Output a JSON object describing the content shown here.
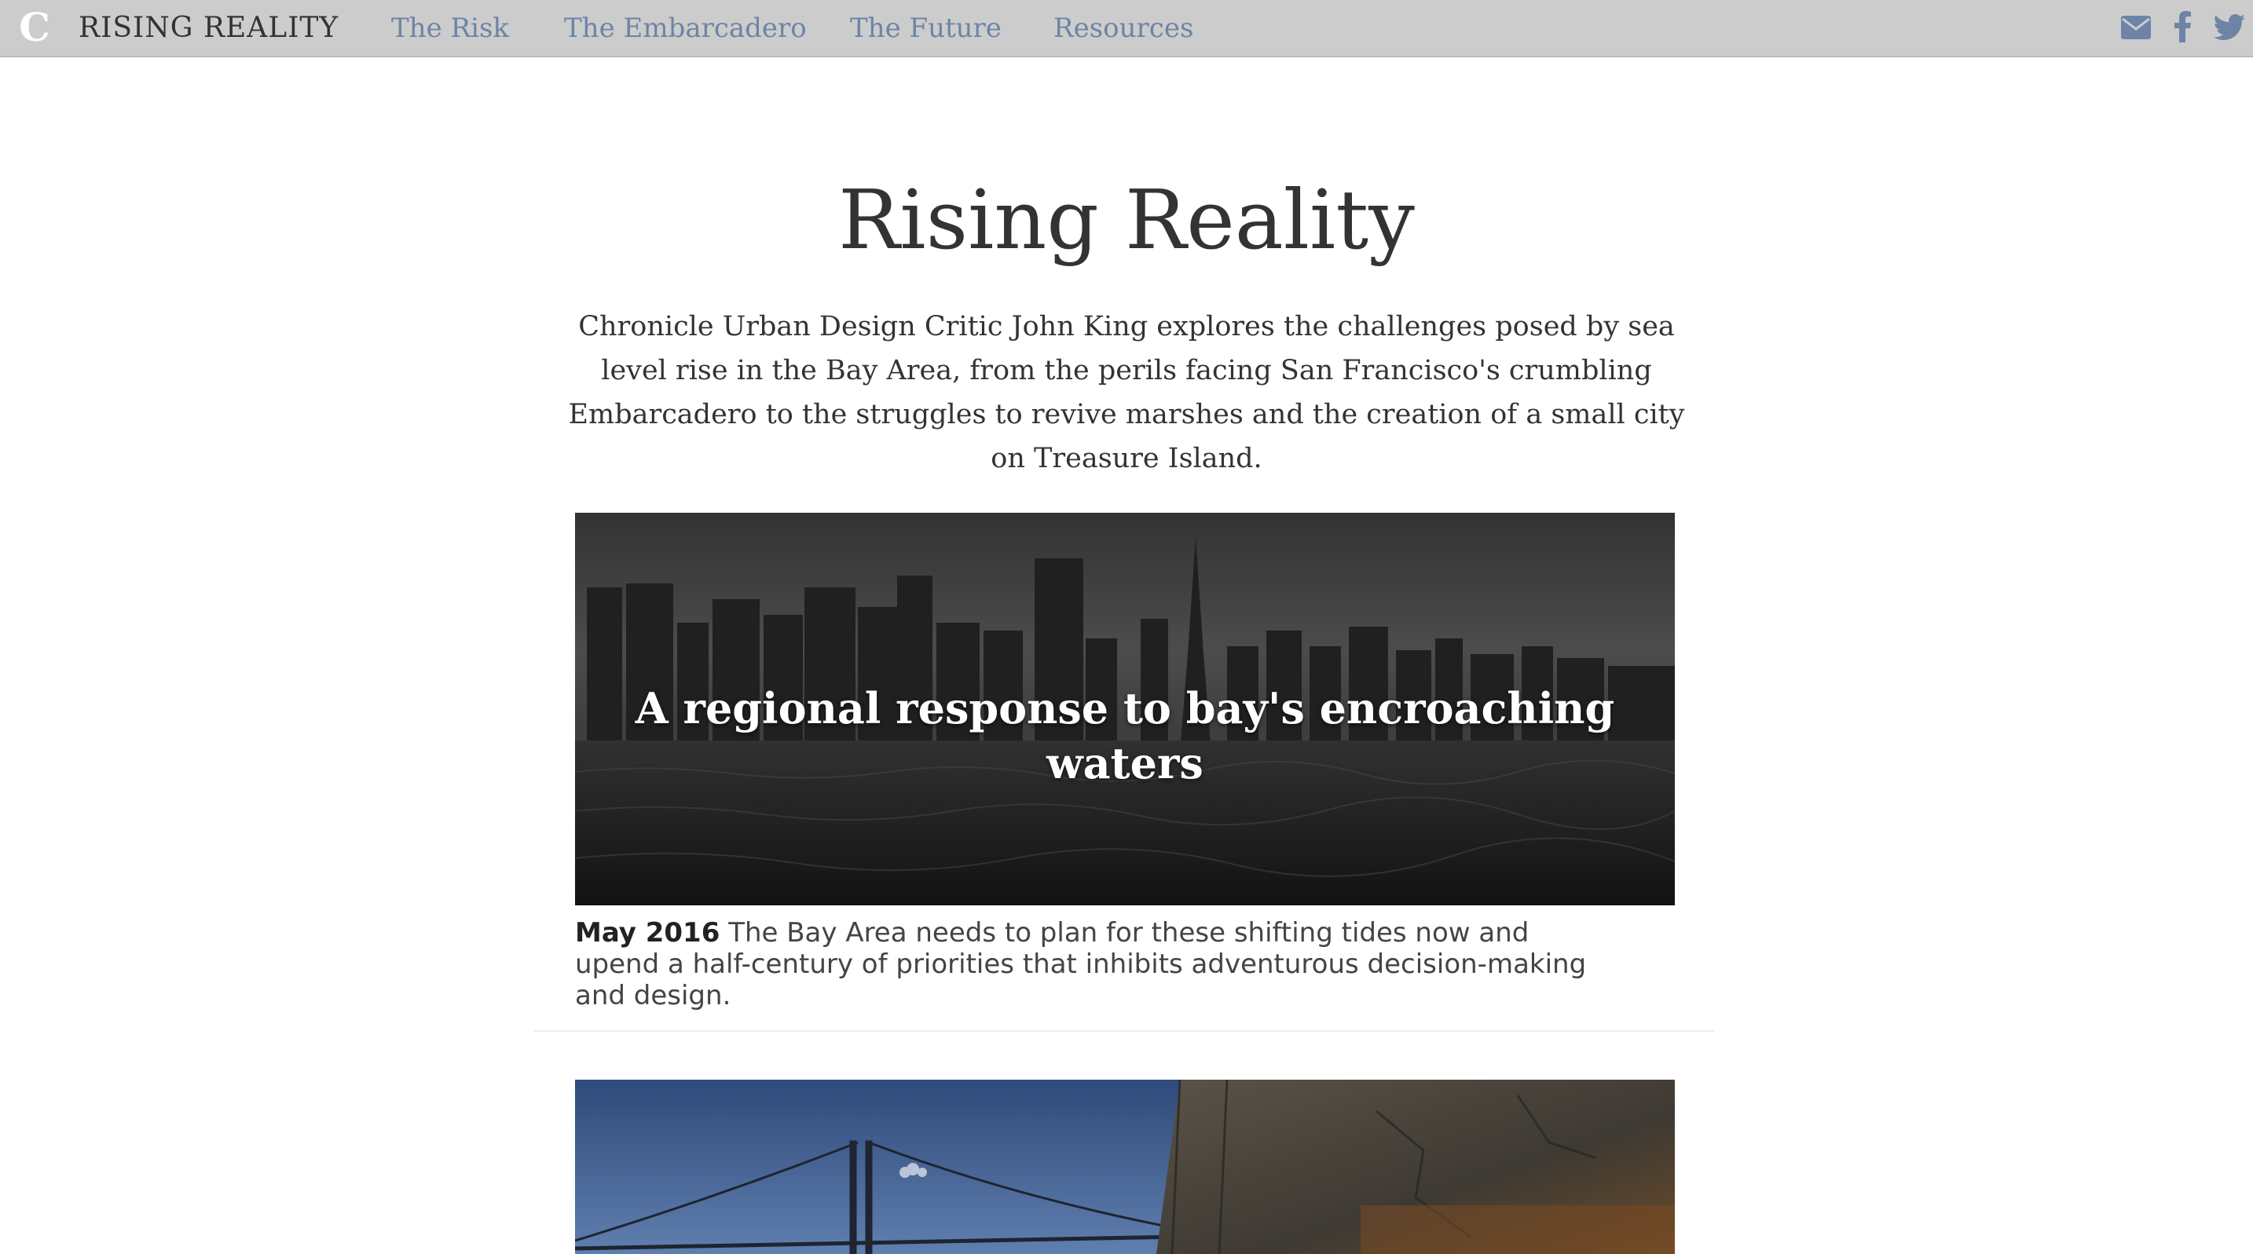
{
  "nav": {
    "logo_glyph": "C",
    "brand": "RISING REALITY",
    "links": [
      "The Risk",
      "The Embarcadero",
      "The Future",
      "Resources"
    ],
    "social_icons": [
      "email-icon",
      "facebook-icon",
      "twitter-icon"
    ]
  },
  "main": {
    "title": "Rising Reality",
    "intro": "Chronicle Urban Design Critic John King explores the challenges posed by sea level rise in the Bay Area, from the perils facing San Francisco's crumbling Embarcadero to the struggles to revive marshes and the creation of a small city on Treasure Island.",
    "stories": [
      {
        "headline": "A regional response to bay's encroaching waters",
        "date": "May 2016",
        "summary": "The Bay Area needs to plan for these shifting tides now and upend a half-century of priorities that inhibits adventurous decision-making and design."
      }
    ]
  },
  "colors": {
    "nav_bg": "#cccccc",
    "nav_link": "#6d84a6",
    "text": "#333333"
  }
}
